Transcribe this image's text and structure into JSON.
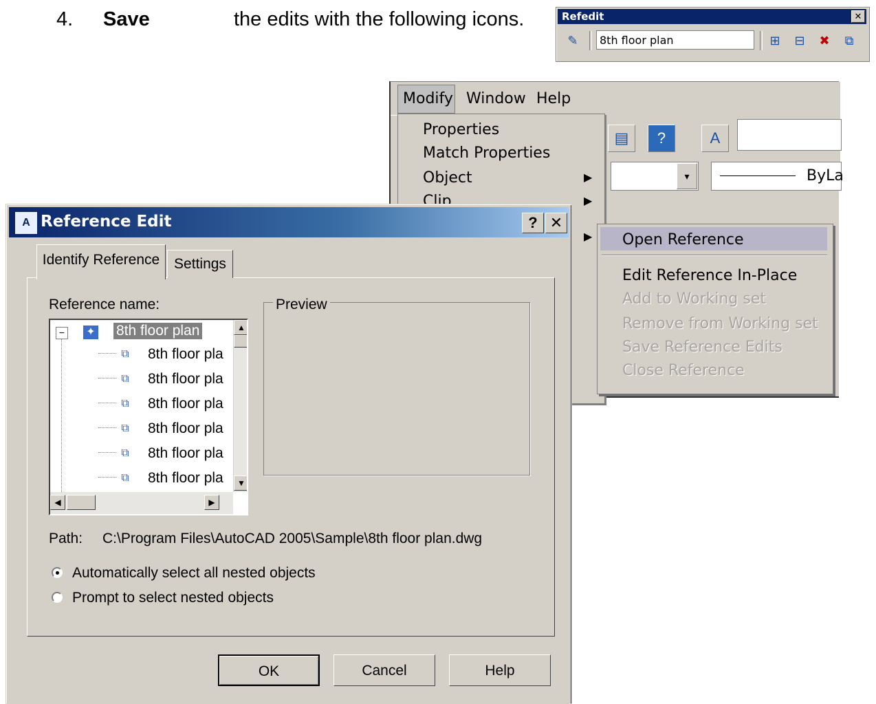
{
  "instruction": {
    "step": "4.",
    "action": "Save",
    "text": "the edits with the following icons."
  },
  "refedit_toolbar": {
    "title": "Refedit",
    "close": "✕",
    "field_value": "8th floor plan",
    "icons": [
      "refedit-icon",
      "add-to-workingset-icon",
      "remove-from-workingset-icon",
      "discard-changes-icon",
      "save-back-changes-icon"
    ]
  },
  "menu": {
    "bar": [
      "Modify",
      "Window",
      "Help"
    ],
    "modify_items": [
      {
        "label": "Properties",
        "has_submenu": false
      },
      {
        "label": "Match Properties",
        "has_submenu": false
      },
      {
        "label": "Object",
        "has_submenu": true
      },
      {
        "label": "Clip",
        "has_submenu": true
      }
    ],
    "bylayer": "ByLa",
    "submenu": [
      {
        "label": "Open Reference",
        "enabled": true,
        "highlighted": true
      },
      {
        "label": "Edit Reference In-Place",
        "enabled": true
      },
      {
        "label": "Add to Working set",
        "enabled": false
      },
      {
        "label": "Remove from Working set",
        "enabled": false
      },
      {
        "label": "Save Reference Edits",
        "enabled": false
      },
      {
        "label": "Close Reference",
        "enabled": false
      }
    ]
  },
  "dialog": {
    "title": "Reference Edit",
    "help_btn": "?",
    "close_btn": "✕",
    "tabs": [
      "Identify Reference",
      "Settings"
    ],
    "reference_name_label": "Reference name:",
    "tree": {
      "root": "8th floor plan",
      "children": [
        "8th floor pla",
        "8th floor pla",
        "8th floor pla",
        "8th floor pla",
        "8th floor pla",
        "8th floor pla"
      ]
    },
    "preview_label": "Preview",
    "path_label": "Path:",
    "path_value": "C:\\Program Files\\AutoCAD 2005\\Sample\\8th floor plan.dwg",
    "radio_auto": "Automatically select all nested objects",
    "radio_prompt": "Prompt to select nested objects",
    "buttons": {
      "ok": "OK",
      "cancel": "Cancel",
      "help": "Help"
    }
  }
}
